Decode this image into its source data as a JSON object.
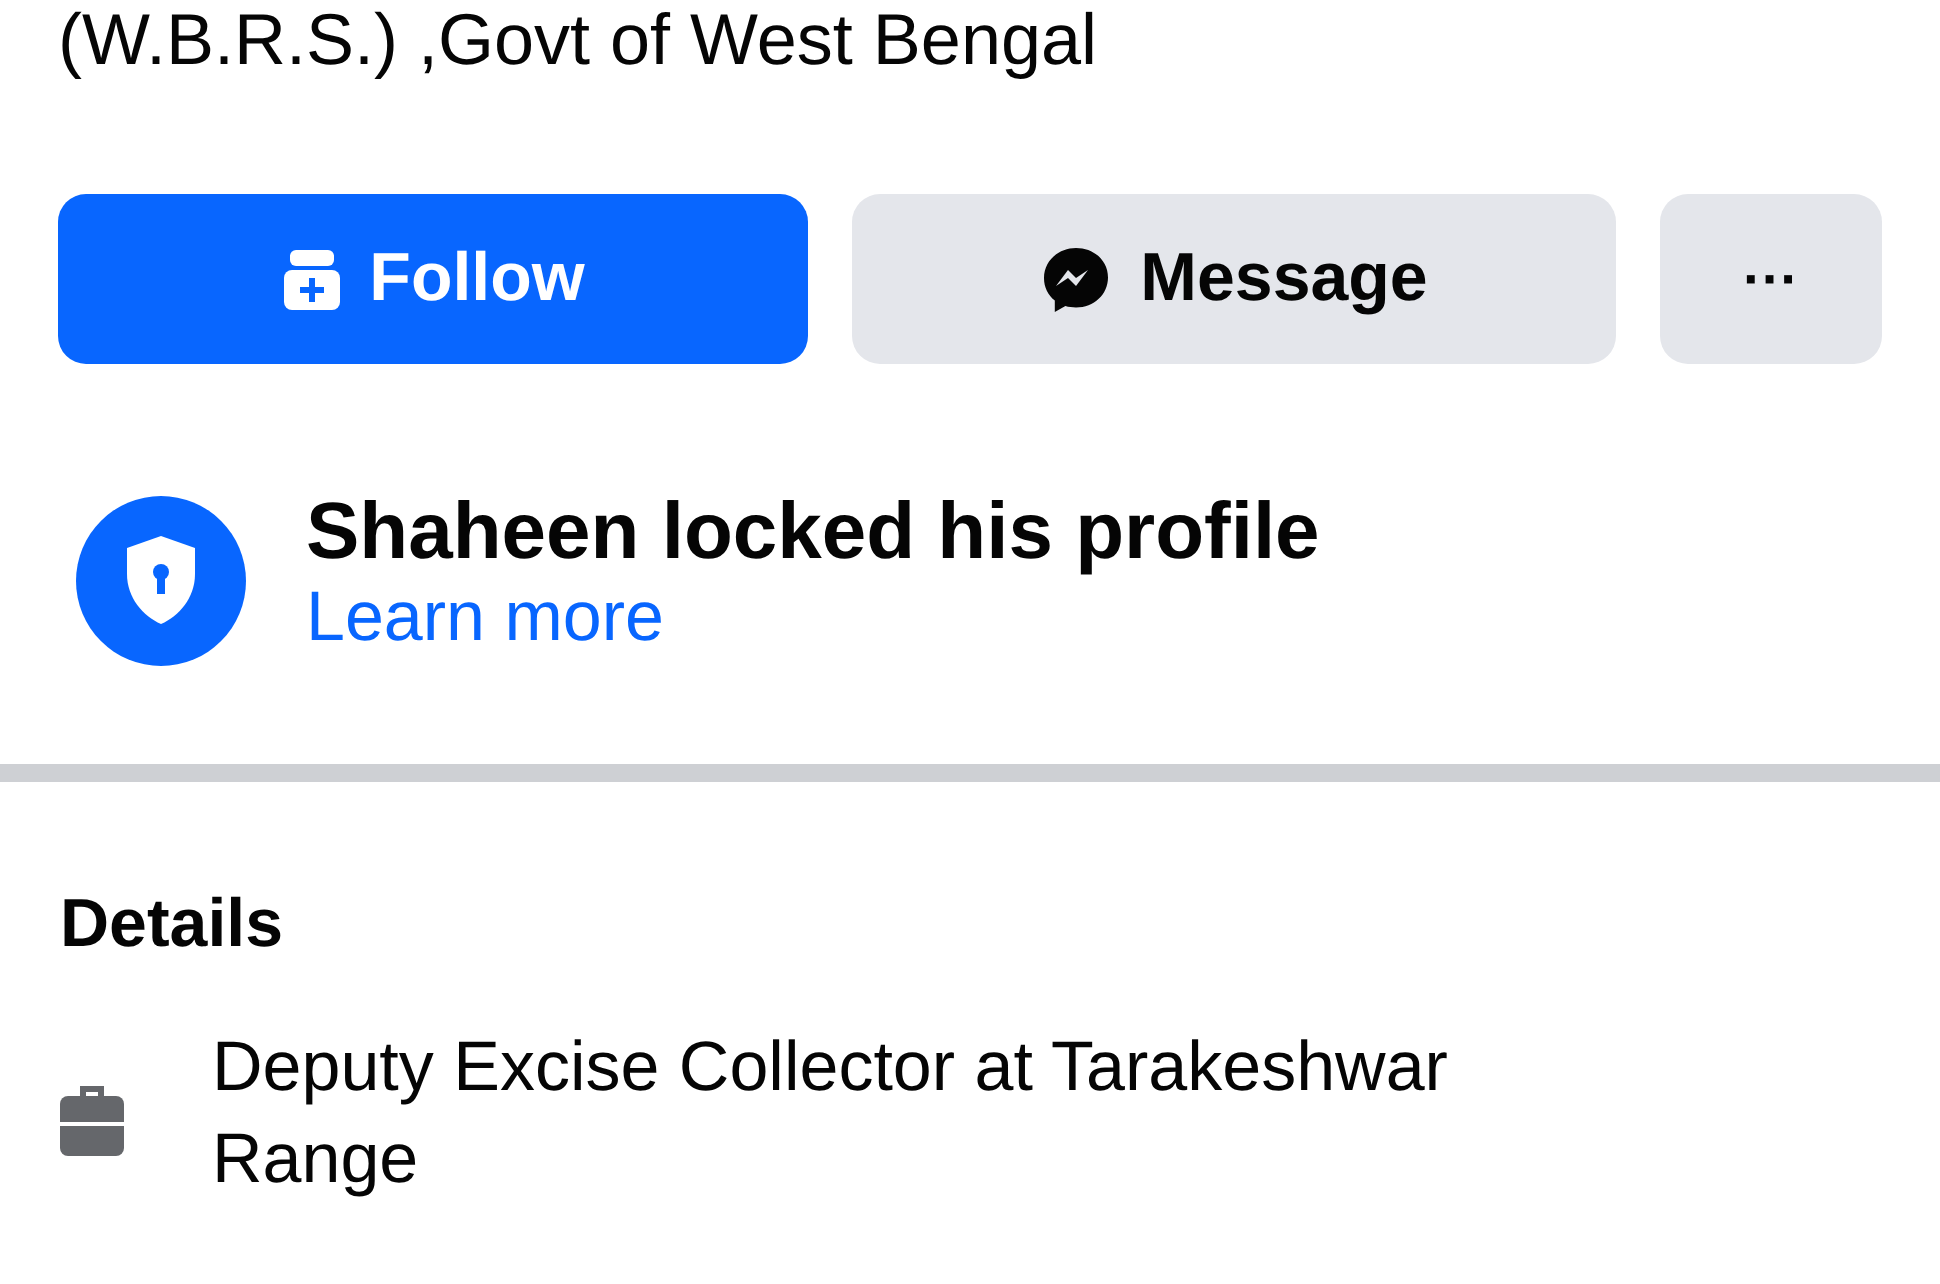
{
  "header": {
    "subtitle": "(W.B.R.S.) ,Govt of West Bengal"
  },
  "actions": [
    {
      "kind": "primary",
      "label": "Follow"
    },
    {
      "kind": "secondary",
      "label": "Message"
    },
    {
      "kind": "more",
      "label": "···"
    }
  ],
  "notice": {
    "title": "Shaheen locked his profile",
    "link": "Learn more"
  },
  "details": {
    "heading": "Details",
    "items": [
      {
        "text": "Deputy Excise Collector at Tarakeshwar Range"
      }
    ]
  }
}
